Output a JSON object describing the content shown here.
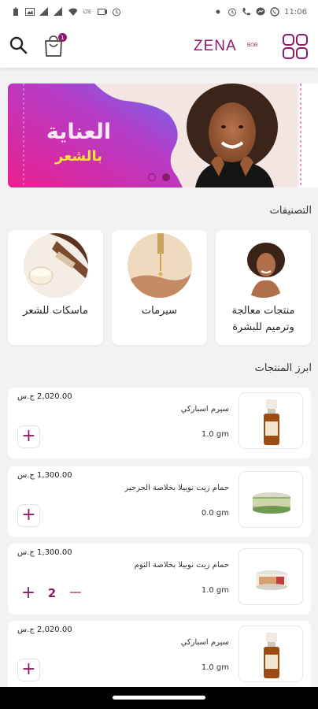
{
  "status_bar": {
    "time": "11:06",
    "lte_text": "LTE"
  },
  "app_bar": {
    "brand": "ZENA",
    "brand_sub": "ᗺᕬᗺ",
    "cart_count": "1"
  },
  "banner": {
    "title": "العناية",
    "subtitle": "بالشعر",
    "slide_count": 2,
    "active_slide": 1
  },
  "categories": {
    "title": "التصنيفات",
    "items": [
      {
        "label": "منتجات معالجة وترميم للبشرة"
      },
      {
        "label": "سيرمات"
      },
      {
        "label": "ماسكات للشعر"
      }
    ]
  },
  "products": {
    "title": "ابرز المنتجات",
    "items": [
      {
        "price": "2,020.00 ج.س",
        "name": "سيرم اسباركي",
        "weight": "1.0 gm",
        "quantity": null
      },
      {
        "price": "1,300.00 ج.س",
        "name": "حمام زيت نوبيلا بخلاصة الجرجير",
        "weight": "0.0 gm",
        "quantity": null
      },
      {
        "price": "1,300.00 ج.س",
        "name": "حمام زيت نوبيلا بخلاصة الثوم",
        "weight": "1.0 gm",
        "quantity": "2"
      },
      {
        "price": "2,020.00 ج.س",
        "name": "سيرم اسباركي",
        "weight": "1.0 gm",
        "quantity": null
      }
    ],
    "plus": "+",
    "minus": "−"
  },
  "colors": {
    "accent": "#8b1a6b",
    "banner_gradient_start": "#e91e8c",
    "banner_gradient_end": "#7a5cf0"
  }
}
